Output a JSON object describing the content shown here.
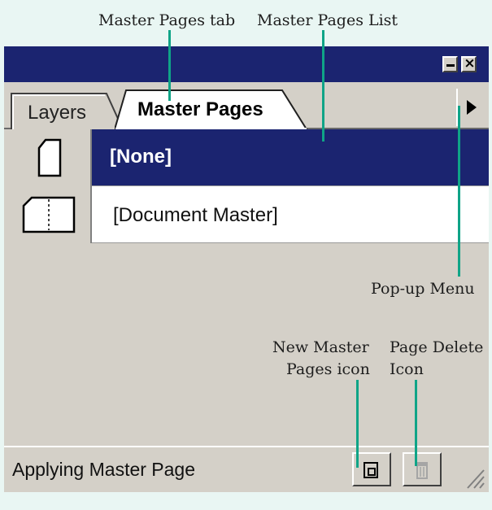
{
  "callouts": {
    "master_pages_tab": "Master Pages tab",
    "master_pages_list": "Master Pages List",
    "popup_menu": "Pop-up Menu",
    "new_master_line1": "New Master",
    "new_master_line2": "Pages icon",
    "page_delete_line1": "Page Delete",
    "page_delete_line2": "Icon"
  },
  "tabs": [
    {
      "label": "Layers",
      "active": false
    },
    {
      "label": "Master Pages",
      "active": true
    }
  ],
  "master_pages": [
    {
      "label": "[None]",
      "selected": true
    },
    {
      "label": "[Document Master]",
      "selected": false
    }
  ],
  "status": {
    "text": "Applying Master Page"
  },
  "icons": {
    "minimize": "minimize-icon",
    "close": "close-icon",
    "popup_menu": "popup-menu-arrow-icon",
    "new_master": "new-master-page-icon",
    "delete": "trash-icon",
    "resize": "resize-grip-icon"
  },
  "colors": {
    "titlebar": "#1b2470",
    "selection": "#1b2470",
    "panel": "#d4d0c8",
    "callout_line": "#0fa487",
    "background": "#e9f6f3"
  }
}
